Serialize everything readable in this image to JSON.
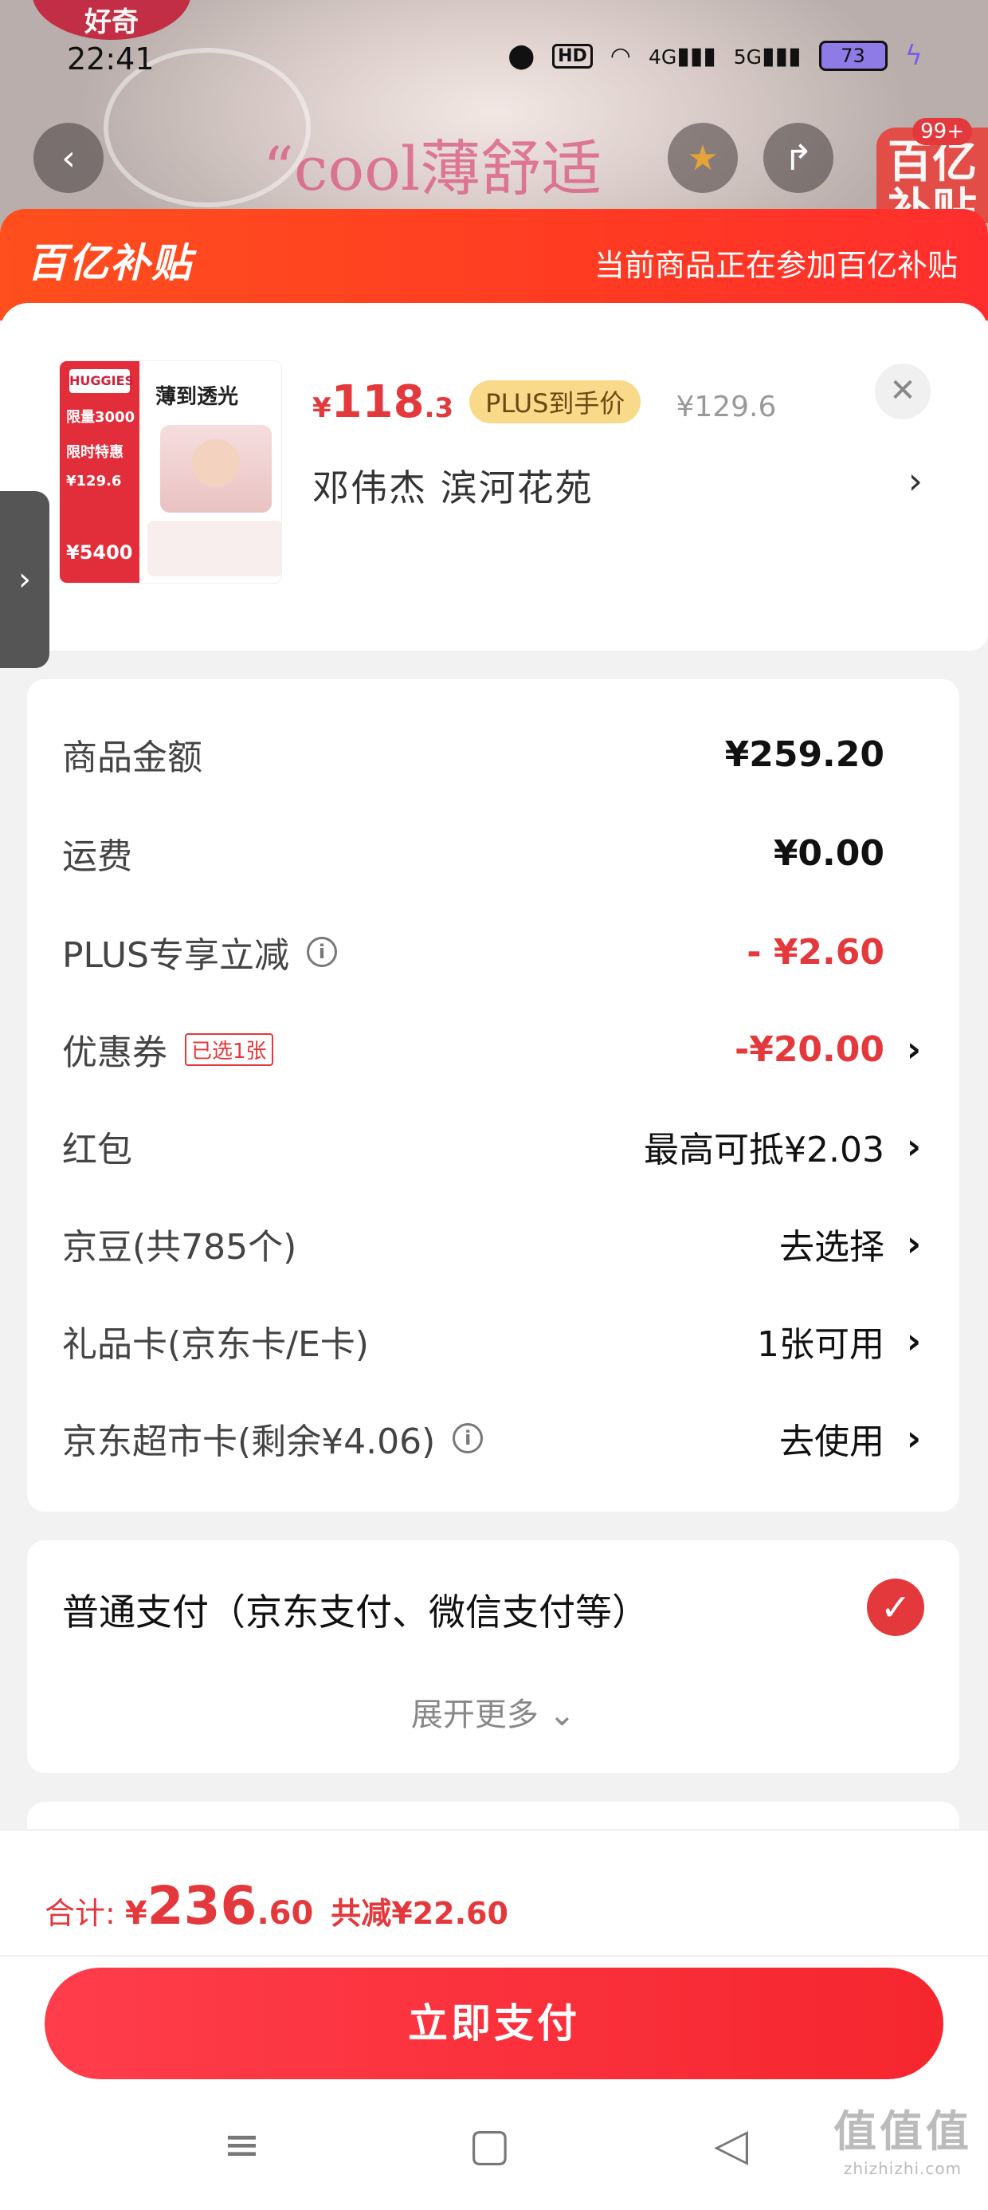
{
  "status_bar": {
    "time": "22:41",
    "hd": "HD",
    "net1": "4G",
    "net2": "5G",
    "battery": "73"
  },
  "top_image": {
    "brand_bubble": "好奇",
    "slogan": "“cool薄舒适"
  },
  "top_nav": {
    "badge": "99+",
    "brand_tag": "百亿补贴"
  },
  "banner": {
    "logo": "百亿补贴",
    "message": "当前商品正在参加百亿补贴"
  },
  "product": {
    "thumb_headline": "薄到透光",
    "thumb_logo": "HUGGIES",
    "thumb_tags": [
      "限量3000",
      "限时特惠",
      "¥129.6",
      "¥5400"
    ],
    "price_symbol": "¥",
    "price_int": "118",
    "price_dec": ".3",
    "plus_tag": "PLUS到手价",
    "original_price": "¥129.6",
    "address": "邓伟杰  滨河花苑"
  },
  "fees": {
    "goods_amount": {
      "label": "商品金额",
      "value": "¥259.20"
    },
    "shipping": {
      "label": "运费",
      "value": "¥0.00"
    },
    "plus_discount": {
      "label": "PLUS专享立减",
      "value": "- ¥2.60"
    },
    "coupon": {
      "label": "优惠券",
      "tag": "已选1张",
      "value": "-¥20.00"
    },
    "red_packet": {
      "label": "红包",
      "value": "最高可抵¥2.03"
    },
    "jingdou": {
      "label": "京豆(共785个)",
      "value": "去选择"
    },
    "gift_card": {
      "label": "礼品卡(京东卡/E卡)",
      "value": "1张可用"
    },
    "supermarket_card": {
      "label": "京东超市卡(剩余¥4.06)",
      "value": "去使用"
    }
  },
  "payment": {
    "option": "普通支付（京东支付、微信支付等）",
    "expand": "展开更多"
  },
  "footer": {
    "total_label": "合计:",
    "total_symbol": "¥",
    "total_int": "236",
    "total_dec": ".60",
    "saved": "共减¥22.60",
    "pay_button": "立即支付"
  },
  "watermark": {
    "main": "值值值",
    "sub": "zhizhizhi.com"
  },
  "colors": {
    "accent": "#e4393c",
    "banner": "#ff3b22",
    "plus_tag": "#f9d98a"
  }
}
